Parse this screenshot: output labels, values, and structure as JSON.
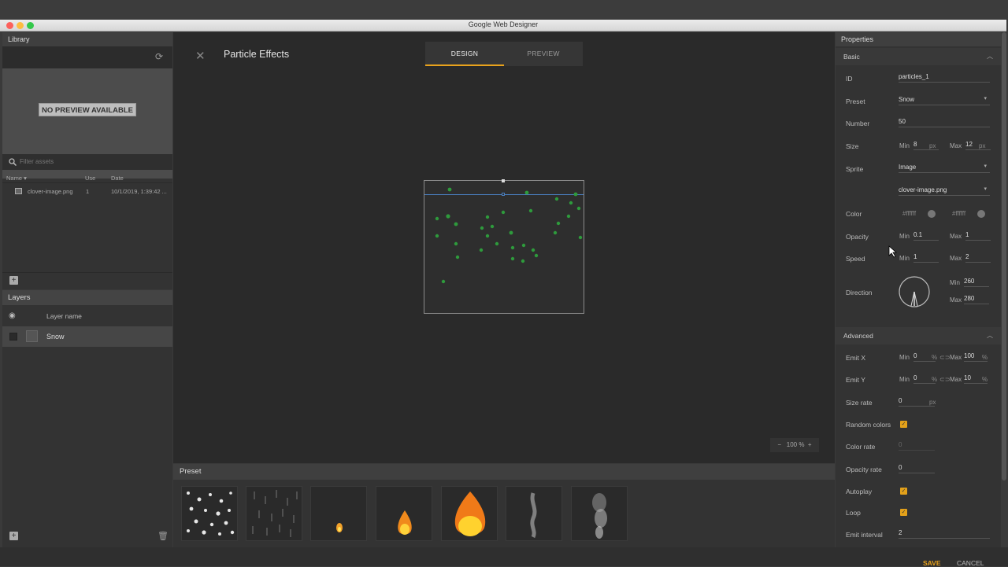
{
  "window": {
    "title": "Google Web Designer"
  },
  "library": {
    "title": "Library",
    "no_preview": "NO PREVIEW AVAILABLE",
    "filter_placeholder": "Filter assets",
    "columns": {
      "name": "Name",
      "use": "Use",
      "date": "Date"
    },
    "assets": [
      {
        "name": "clover-image.png",
        "use": "1",
        "date": "10/1/2019, 1:39:42 ..."
      }
    ]
  },
  "layers": {
    "title": "Layers",
    "column_label": "Layer name",
    "items": [
      {
        "name": "Snow"
      }
    ]
  },
  "dialog": {
    "title": "Particle Effects",
    "tabs": [
      {
        "label": "DESIGN",
        "active": true
      },
      {
        "label": "PREVIEW",
        "active": false
      }
    ],
    "zoom": {
      "minus": "−",
      "value": "100 %",
      "plus": "+"
    }
  },
  "preset": {
    "title": "Preset",
    "thumbs": [
      "snow",
      "rain",
      "small-flame",
      "medium-flame",
      "large-flame",
      "thin-smoke",
      "thick-smoke"
    ]
  },
  "properties": {
    "title": "Properties",
    "basic": {
      "title": "Basic",
      "id_label": "ID",
      "id_value": "particles_1",
      "preset_label": "Preset",
      "preset_value": "Snow",
      "number_label": "Number",
      "number_value": "50",
      "size_label": "Size",
      "size_min": "8",
      "size_max": "12",
      "size_unit": "px",
      "sprite_label": "Sprite",
      "sprite_value": "Image",
      "sprite_file": "clover-image.png",
      "color_label": "Color",
      "color_min": "#ffffff",
      "color_max": "#ffffff",
      "opacity_label": "Opacity",
      "opacity_min": "0.1",
      "opacity_max": "1",
      "speed_label": "Speed",
      "speed_min": "1",
      "speed_max": "2",
      "direction_label": "Direction",
      "direction_min": "260",
      "direction_max": "280",
      "min_label": "Min",
      "max_label": "Max"
    },
    "advanced": {
      "title": "Advanced",
      "emitx_label": "Emit X",
      "emitx_min": "0",
      "emitx_max": "100",
      "emity_label": "Emit Y",
      "emity_min": "0",
      "emity_max": "10",
      "pct": "%",
      "sizerate_label": "Size rate",
      "sizerate_value": "0",
      "px": "px",
      "randomcolors_label": "Random colors",
      "colorrate_label": "Color rate",
      "colorrate_value": "0",
      "opacityrate_label": "Opacity rate",
      "opacityrate_value": "0",
      "autoplay_label": "Autoplay",
      "loop_label": "Loop",
      "emitinterval_label": "Emit interval",
      "emitinterval_value": "2"
    }
  },
  "footer": {
    "save": "SAVE",
    "cancel": "CANCEL"
  },
  "colors": {
    "accent": "#e8a21c",
    "particle": "#2e9a3c",
    "emitter": "#4a7fc0"
  }
}
